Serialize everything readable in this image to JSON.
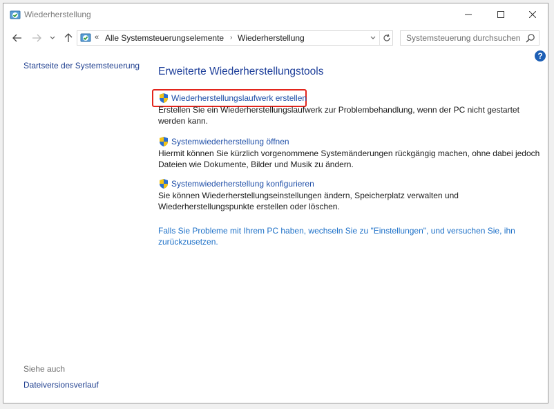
{
  "window": {
    "title": "Wiederherstellung"
  },
  "nav": {
    "overflow": "«",
    "breadcrumbs": [
      "Alle Systemsteuerungselemente",
      "Wiederherstellung"
    ],
    "search_placeholder": "Systemsteuerung durchsuchen"
  },
  "sidebar": {
    "home_link": "Startseite der Systemsteuerung",
    "see_also_label": "Siehe auch",
    "history_link": "Dateiversionsverlauf"
  },
  "main": {
    "title": "Erweiterte Wiederherstellungstools",
    "tasks": [
      {
        "label": "Wiederherstellungslaufwerk erstellen",
        "description": "Erstellen Sie ein Wiederherstellungslaufwerk zur Problembehandlung, wenn der PC nicht gestartet werden kann."
      },
      {
        "label": "Systemwiederherstellung öffnen",
        "description": "Hiermit können Sie kürzlich vorgenommene Systemänderungen rückgängig machen, ohne dabei jedoch Dateien wie Dokumente, Bilder und Musik zu ändern."
      },
      {
        "label": "Systemwiederherstellung konfigurieren",
        "description": "Sie können Wiederherstellungseinstellungen ändern, Speicherplatz verwalten und Wiederherstellungspunkte erstellen oder löschen."
      }
    ],
    "settings_link": "Falls Sie Probleme mit Ihrem PC haben, wechseln Sie zu \"Einstellungen\", und versuchen Sie, ihn zurückzusetzen."
  },
  "help": {
    "label": "?"
  },
  "colors": {
    "link": "#1f4fa8",
    "title": "#1e3f9a",
    "highlight": "#e3251c",
    "shield_blue": "#2a6fd0",
    "shield_yellow": "#f2c318"
  }
}
